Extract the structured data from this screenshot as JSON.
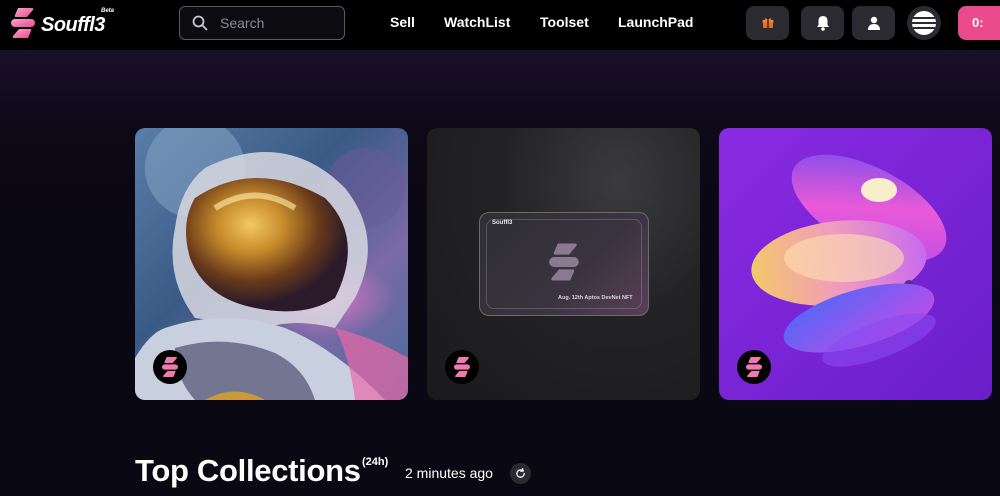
{
  "app": {
    "brand": "Souffl3",
    "brand_tag": "Beta"
  },
  "header": {
    "search_placeholder": "Search",
    "nav": [
      {
        "label": "Sell"
      },
      {
        "label": "WatchList"
      },
      {
        "label": "Toolset"
      },
      {
        "label": "LaunchPad"
      }
    ],
    "connect_label": "0:"
  },
  "featured": {
    "cards": [
      {
        "name": "painted astronaut"
      },
      {
        "brand": "Souffl3",
        "caption": "Aug. 12th   Aptos DevNet NFT"
      },
      {
        "name": "abstract shapes"
      }
    ]
  },
  "collections": {
    "title": "Top Collections",
    "period": "(24h)",
    "updated": "2 minutes ago"
  },
  "colors": {
    "accent": "#e84a8b",
    "background": "#0a0812",
    "card3": "#8a2be2"
  }
}
